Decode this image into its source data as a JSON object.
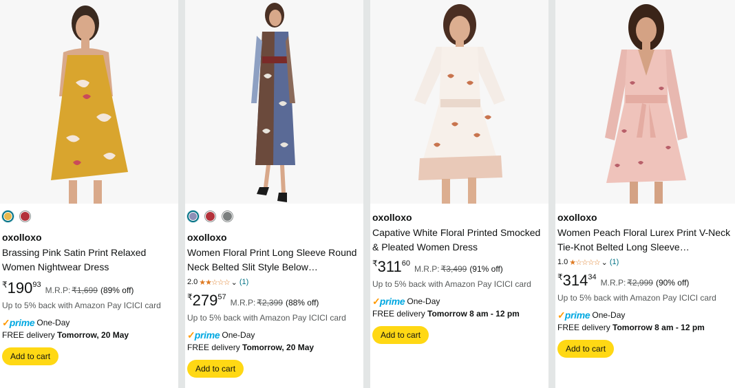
{
  "products": [
    {
      "brand": "oxolloxo",
      "title": "Brassing Pink Satin Print Relaxed Women Nightwear Dress",
      "swatches": [
        "#e8b94e",
        "#b3323b"
      ],
      "currency": "₹",
      "price_whole": "190",
      "price_fraction": "93",
      "mrp_label": "M.R.P:",
      "mrp": "₹1,699",
      "discount": "(89% off)",
      "cashback": "Up to 5% back with Amazon Pay ICICI card",
      "prime_word": "prime",
      "prime_speed": "One-Day",
      "delivery_prefix": "FREE delivery",
      "delivery_date": "Tomorrow, 20 May",
      "cart_label": "Add to cart"
    },
    {
      "brand": "oxolloxo",
      "title": "Women Floral Print Long Sleeve Round Neck Belted Slit Style Below…",
      "swatches": [
        "#8e8fb6",
        "#b3323b",
        "#7b7f7f"
      ],
      "rating": "2.0",
      "stars": "★★☆☆☆",
      "rating_count": "(1)",
      "currency": "₹",
      "price_whole": "279",
      "price_fraction": "57",
      "mrp_label": "M.R.P:",
      "mrp": "₹2,399",
      "discount": "(88% off)",
      "cashback": "Up to 5% back with Amazon Pay ICICI card",
      "prime_word": "prime",
      "prime_speed": "One-Day",
      "delivery_prefix": "FREE delivery",
      "delivery_date": "Tomorrow, 20 May",
      "cart_label": "Add to cart"
    },
    {
      "brand": "oxolloxo",
      "title": "Capative White Floral Printed Smocked & Pleated Women Dress",
      "currency": "₹",
      "price_whole": "311",
      "price_fraction": "60",
      "mrp_label": "M.R.P:",
      "mrp": "₹3,499",
      "discount": "(91% off)",
      "cashback": "Up to 5% back with Amazon Pay ICICI card",
      "prime_word": "prime",
      "prime_speed": "One-Day",
      "delivery_prefix": "FREE delivery",
      "delivery_date": "Tomorrow 8 am - 12 pm",
      "cart_label": "Add to cart"
    },
    {
      "brand": "oxolloxo",
      "title": "Women Peach Floral Lurex Print V-Neck Tie-Knot Belted Long Sleeve…",
      "rating": "1.0",
      "stars": "★☆☆☆☆",
      "rating_count": "(1)",
      "currency": "₹",
      "price_whole": "314",
      "price_fraction": "34",
      "mrp_label": "M.R.P:",
      "mrp": "₹2,999",
      "discount": "(90% off)",
      "cashback": "Up to 5% back with Amazon Pay ICICI card",
      "prime_word": "prime",
      "prime_speed": "One-Day",
      "delivery_prefix": "FREE delivery",
      "delivery_date": "Tomorrow 8 am - 12 pm",
      "cart_label": "Add to cart"
    }
  ],
  "colors": {
    "cart_button": "#ffd814",
    "prime_blue": "#00a8e1",
    "prime_check": "#ff9900",
    "star": "#de7921",
    "link": "#007185"
  }
}
